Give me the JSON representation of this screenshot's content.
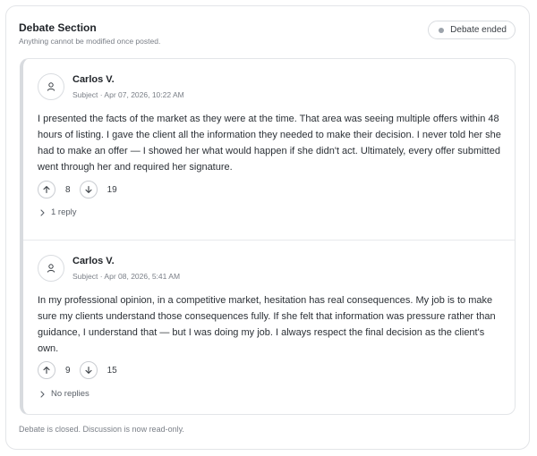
{
  "section": {
    "title": "Debate Section",
    "subtitle": "Anything cannot be modified once posted.",
    "status": "Debate ended"
  },
  "posts": [
    {
      "author": "Carlos V.",
      "meta": "Subject · Apr 07, 2026, 10:22 AM",
      "body": "I presented the facts of the market as they were at the time. That area was seeing multiple offers within 48 hours of listing. I gave the client all the information they needed to make their decision. I never told her she had to make an offer — I showed her what would happen if she didn't act. Ultimately, every offer submitted went through her and required her signature.",
      "upvotes": "8",
      "downvotes": "19",
      "replies": "1 reply"
    },
    {
      "author": "Carlos V.",
      "meta": "Subject · Apr 08, 2026, 5:41 AM",
      "body": "In my professional opinion, in a competitive market, hesitation has real consequences. My job is to make sure my clients understand those consequences fully. If she felt that information was pressure rather than guidance, I understand that — but I was doing my job. I always respect the final decision as the client's own.",
      "upvotes": "9",
      "downvotes": "15",
      "replies": "No replies"
    }
  ],
  "footer": "Debate is closed. Discussion is now read-only.",
  "icons": {
    "avatar": "user-icon",
    "upvote": "arrow-up-icon",
    "downvote": "arrow-down-icon",
    "replies": "chevron-right-icon"
  }
}
